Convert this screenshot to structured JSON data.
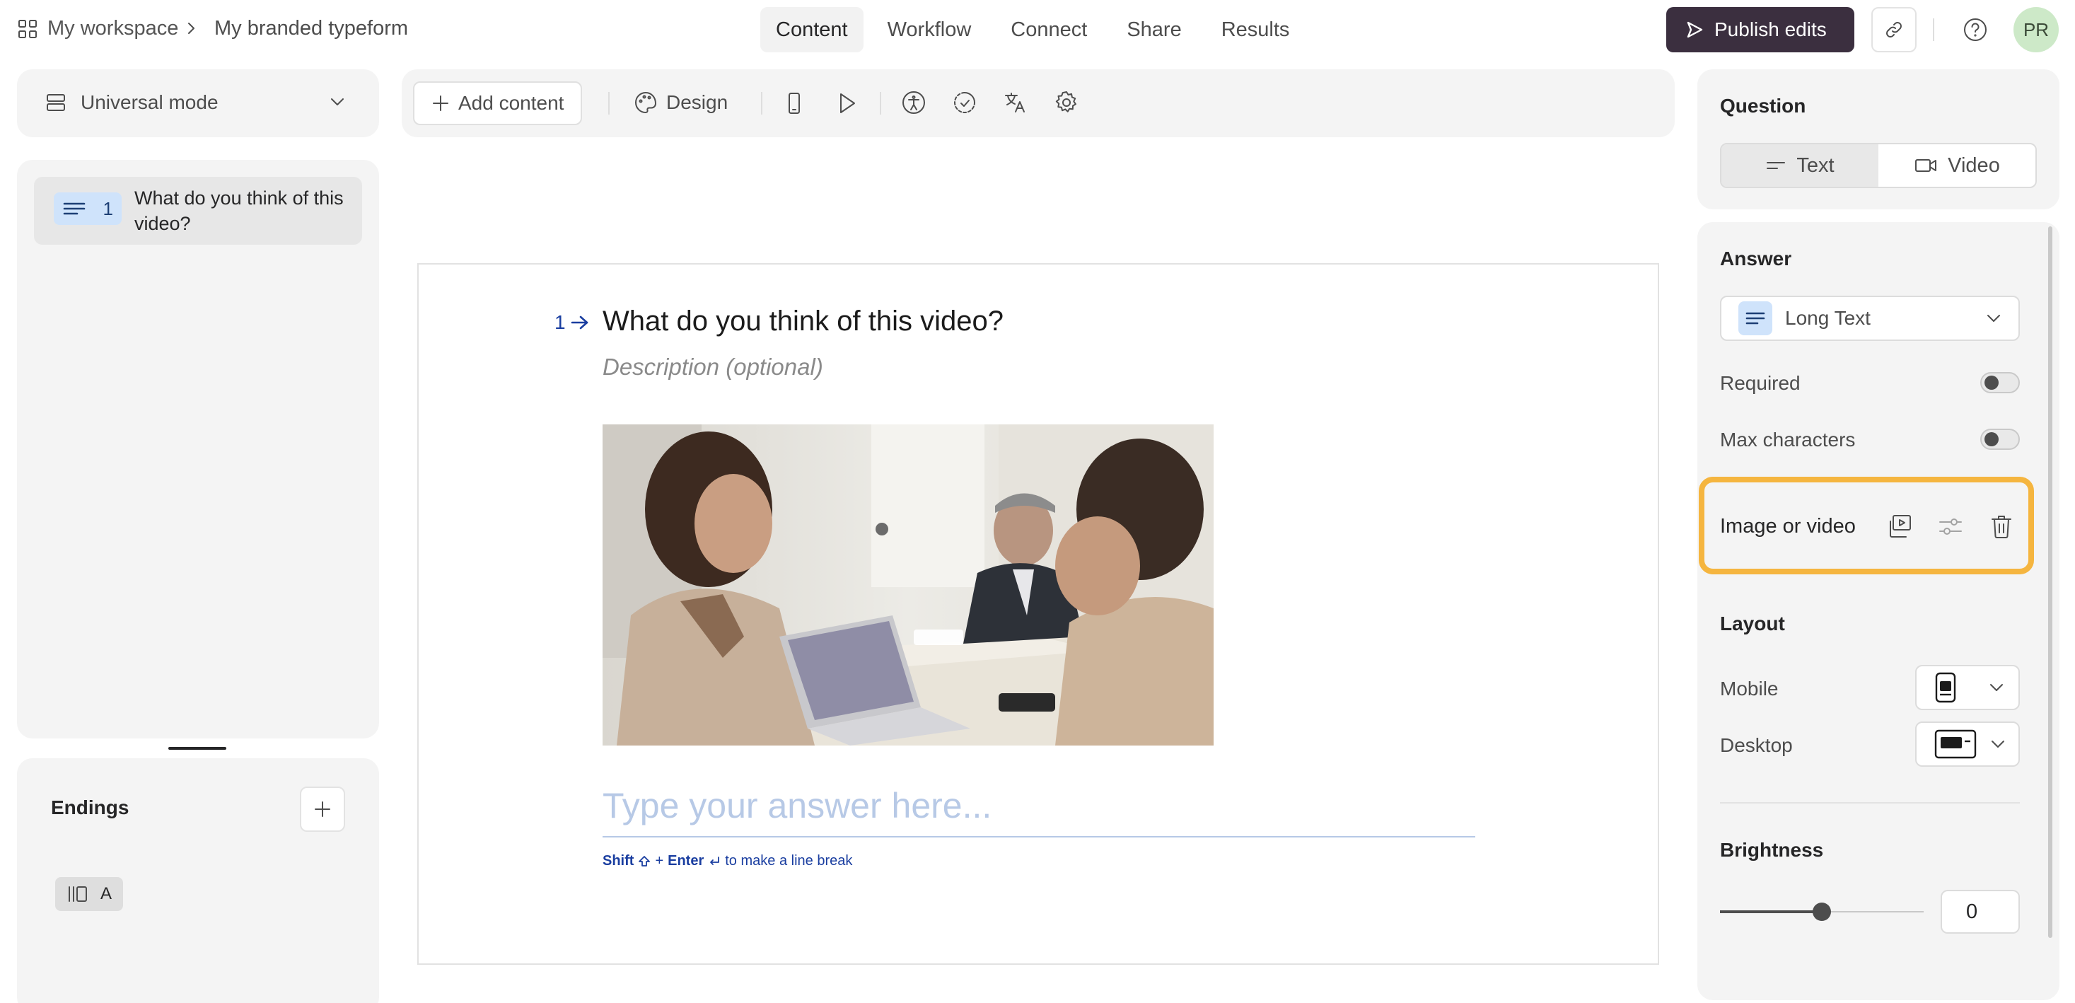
{
  "header": {
    "breadcrumb": {
      "workspace": "My workspace",
      "form": "My branded typeform"
    },
    "tabs": [
      {
        "label": "Content",
        "active": true
      },
      {
        "label": "Workflow",
        "active": false
      },
      {
        "label": "Connect",
        "active": false
      },
      {
        "label": "Share",
        "active": false
      },
      {
        "label": "Results",
        "active": false
      }
    ],
    "publish_label": "Publish edits",
    "avatar_initials": "PR"
  },
  "left": {
    "mode_label": "Universal mode",
    "questions": [
      {
        "number": "1",
        "text": "What do you think of this video?"
      }
    ],
    "endings_label": "Endings",
    "ending_tag": "A"
  },
  "toolbar": {
    "add_content": "Add content",
    "design": "Design"
  },
  "canvas": {
    "question_number": "1",
    "question_title": "What do you think of this video?",
    "description_placeholder": "Description (optional)",
    "answer_placeholder": "Type your answer here...",
    "hint": {
      "shift": "Shift",
      "plus": "+",
      "enter": "Enter",
      "rest": "to make a line break"
    },
    "image_description": "photo of four people meeting around a table with a laptop"
  },
  "right": {
    "question_section": "Question",
    "question_type_options": [
      "Text",
      "Video"
    ],
    "question_type_selected": "Text",
    "answer_section": "Answer",
    "answer_type": "Long Text",
    "required_label": "Required",
    "required_on": false,
    "max_chars_label": "Max characters",
    "max_chars_on": false,
    "image_or_video_label": "Image or video",
    "layout_section": "Layout",
    "mobile_label": "Mobile",
    "desktop_label": "Desktop",
    "brightness_section": "Brightness",
    "brightness_value": "0",
    "brightness_level_fraction": 0.5
  },
  "colors": {
    "accent_highlight": "#f5b53f",
    "publish_bg": "#3b2f3f",
    "question_tag_bg": "#cfe3fb",
    "avatar_bg": "#cde9c8",
    "link_blue": "#1a3ea0"
  }
}
